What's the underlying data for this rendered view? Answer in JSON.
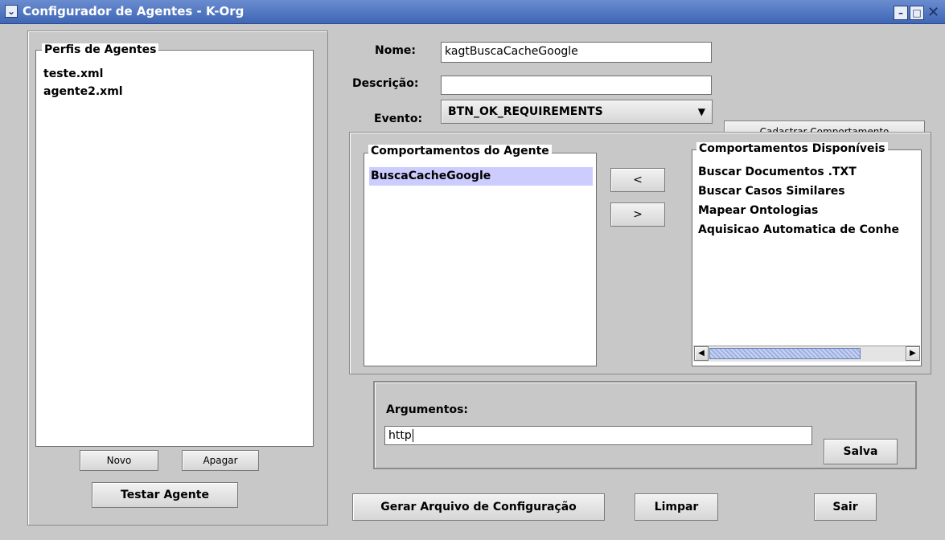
{
  "window": {
    "title": "Configurador de Agentes - K-Org"
  },
  "profiles": {
    "legend": "Perfis de Agentes",
    "items": [
      "teste.xml",
      "agente2.xml"
    ],
    "new_label": "Novo",
    "delete_label": "Apagar",
    "test_label": "Testar Agente"
  },
  "form": {
    "name_label": "Nome:",
    "name_value": "kagtBuscaCacheGoogle",
    "description_label": "Descrição:",
    "description_value": "",
    "event_label": "Evento:",
    "event_value": "BTN_OK_REQUIREMENTS",
    "register_label": "Cadastrar Comportamento"
  },
  "behaviors": {
    "agent_legend": "Comportamentos do Agente",
    "agent_items": [
      "BuscaCacheGoogle"
    ],
    "move_left_label": "<",
    "move_right_label": ">",
    "available_legend": "Comportamentos Disponíveis",
    "available_items": [
      "Buscar Documentos .TXT",
      "Buscar Casos Similares",
      "Mapear Ontologias",
      "Aquisicao Automatica de Conhe"
    ]
  },
  "arguments": {
    "label": "Argumentos:",
    "value": "http",
    "save_label": "Salva"
  },
  "footer": {
    "generate_label": "Gerar Arquivo de Configuração",
    "clear_label": "Limpar",
    "exit_label": "Sair"
  },
  "colors": {
    "titlebar": "#4f74c0",
    "selection": "#ccccff"
  }
}
